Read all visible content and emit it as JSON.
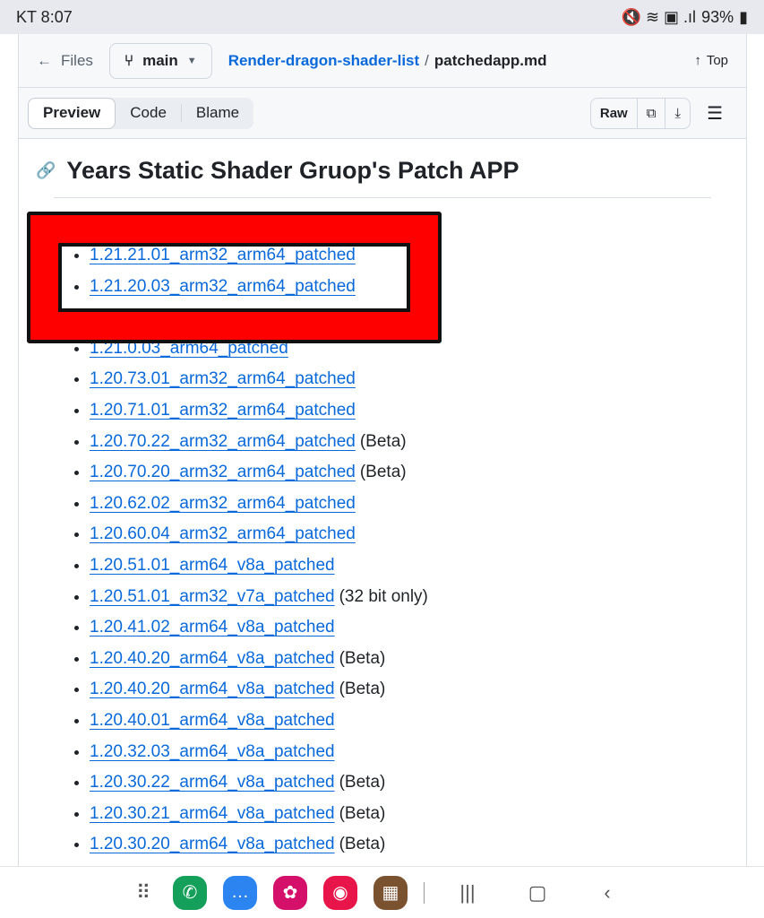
{
  "status": {
    "carrier_time": "KT 8:07",
    "battery": "93%",
    "icons": [
      "mute-icon",
      "wifi-icon",
      "hd-icon",
      "signal-icon",
      "battery-icon"
    ]
  },
  "header": {
    "files": "Files",
    "branch": "main",
    "repo": "Render-dragon-shader-list",
    "separator": "/",
    "file": "patchedapp.md",
    "top": "Top"
  },
  "toolbar": {
    "tabs": [
      "Preview",
      "Code",
      "Blame"
    ],
    "raw": "Raw"
  },
  "content": {
    "title": "Years Static Shader Gruop's Patch APP",
    "items": [
      {
        "link": "1.21.21.01_arm32_arm64_patched",
        "note": ""
      },
      {
        "link": "1.21.20.03_arm32_arm64_patched",
        "note": ""
      },
      {
        "link": "",
        "note": ""
      },
      {
        "link": "1.21.0.03_arm64_patched",
        "note": ""
      },
      {
        "link": "1.20.73.01_arm32_arm64_patched",
        "note": ""
      },
      {
        "link": "1.20.71.01_arm32_arm64_patched",
        "note": ""
      },
      {
        "link": "1.20.70.22_arm32_arm64_patched",
        "note": "(Beta)"
      },
      {
        "link": "1.20.70.20_arm32_arm64_patched",
        "note": "(Beta)"
      },
      {
        "link": "1.20.62.02_arm32_arm64_patched",
        "note": ""
      },
      {
        "link": "1.20.60.04_arm32_arm64_patched",
        "note": ""
      },
      {
        "link": "1.20.51.01_arm64_v8a_patched",
        "note": ""
      },
      {
        "link": "1.20.51.01_arm32_v7a_patched",
        "note": "(32 bit only)"
      },
      {
        "link": "1.20.41.02_arm64_v8a_patched",
        "note": ""
      },
      {
        "link": "1.20.40.20_arm64_v8a_patched",
        "note": "(Beta)"
      },
      {
        "link": "1.20.40.20_arm64_v8a_patched",
        "note": "(Beta)"
      },
      {
        "link": "1.20.40.01_arm64_v8a_patched",
        "note": ""
      },
      {
        "link": "1.20.32.03_arm64_v8a_patched",
        "note": ""
      },
      {
        "link": "1.20.30.22_arm64_v8a_patched",
        "note": "(Beta)"
      },
      {
        "link": "1.20.30.21_arm64_v8a_patched",
        "note": "(Beta)"
      },
      {
        "link": "1.20.30.20_arm64_v8a_patched",
        "note": "(Beta)"
      }
    ]
  },
  "annotation": {
    "color": "#ff0000"
  },
  "navbar": {
    "apps": [
      {
        "name": "phone",
        "color": "#14a05a"
      },
      {
        "name": "messages",
        "color": "#2b84f0"
      },
      {
        "name": "blossom",
        "color": "#d4106a"
      },
      {
        "name": "camera",
        "color": "#e8154a"
      },
      {
        "name": "minecraft",
        "color": "#7a5230"
      }
    ]
  }
}
